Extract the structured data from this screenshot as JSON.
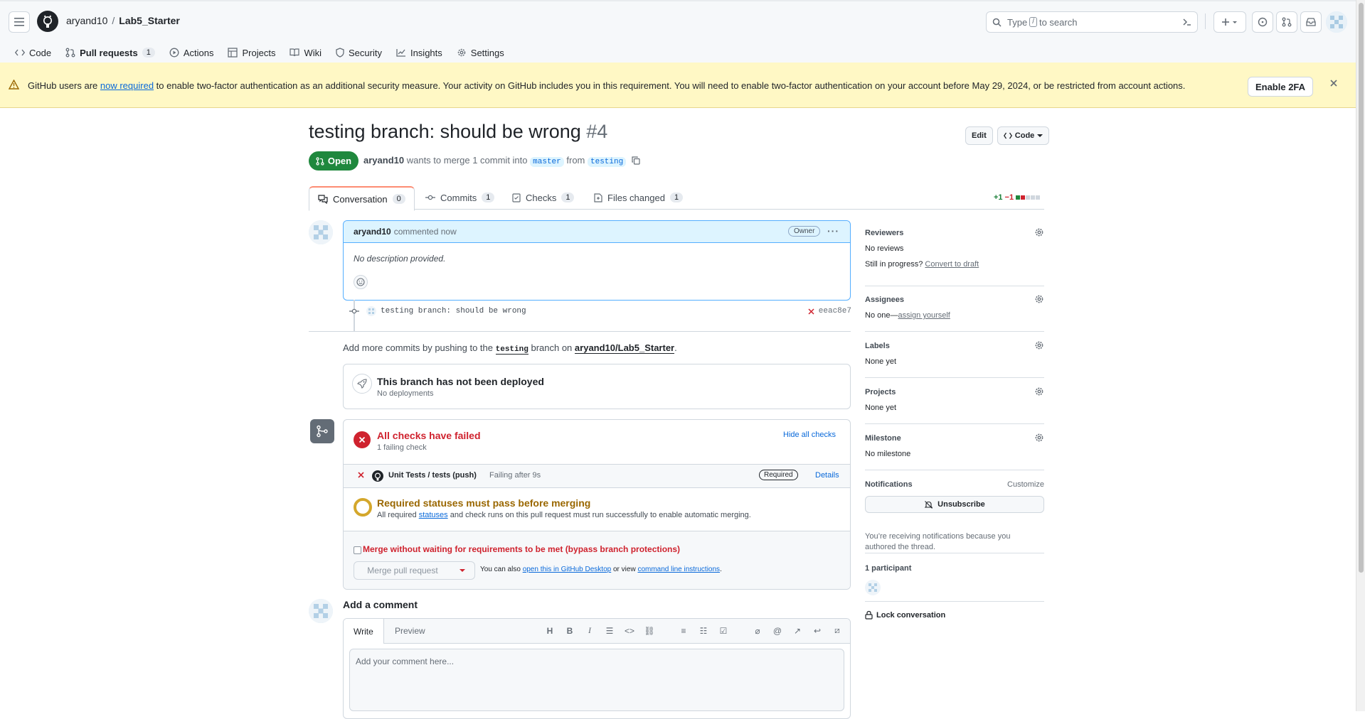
{
  "header": {
    "owner": "aryand10",
    "separator": "/",
    "repo": "Lab5_Starter",
    "search_placeholder_pre": "Type",
    "search_key": "/",
    "search_placeholder_post": "to search"
  },
  "repo_nav": [
    {
      "label": "Code",
      "icon": "code-icon"
    },
    {
      "label": "Pull requests",
      "icon": "pull-request-icon",
      "count": "1",
      "active": true
    },
    {
      "label": "Actions",
      "icon": "play-icon"
    },
    {
      "label": "Projects",
      "icon": "table-icon"
    },
    {
      "label": "Wiki",
      "icon": "book-icon"
    },
    {
      "label": "Security",
      "icon": "shield-icon"
    },
    {
      "label": "Insights",
      "icon": "graph-icon"
    },
    {
      "label": "Settings",
      "icon": "gear-icon"
    }
  ],
  "banner": {
    "text_pre": "GitHub users are",
    "link": "now required",
    "text_post": "to enable two-factor authentication as an additional security measure. Your activity on GitHub includes you in this requirement. You will need to enable two-factor authentication on your account before May 29, 2024, or be restricted from account actions.",
    "button": "Enable 2FA"
  },
  "pr": {
    "title": "testing branch: should be wrong",
    "number": "#4",
    "edit": "Edit",
    "code": "Code",
    "state": "Open",
    "author": "aryand10",
    "meta_mid": "wants to merge 1 commit into",
    "base": "master",
    "from": "from",
    "head": "testing"
  },
  "tabs": [
    {
      "label": "Conversation",
      "count": "0"
    },
    {
      "label": "Commits",
      "count": "1"
    },
    {
      "label": "Checks",
      "count": "1"
    },
    {
      "label": "Files changed",
      "count": "1"
    }
  ],
  "diffstat": {
    "add": "+1",
    "del": "−1"
  },
  "comment": {
    "author": "aryand10",
    "action": "commented now",
    "badge": "Owner",
    "body": "No description provided."
  },
  "commit": {
    "message": "testing branch: should be wrong",
    "sha": "eeac8e7"
  },
  "addmore": {
    "pre": "Add more commits by pushing to the",
    "branch": "testing",
    "mid": "branch on",
    "repo": "aryand10/Lab5_Starter",
    "end": "."
  },
  "deploy": {
    "title": "This branch has not been deployed",
    "sub": "No deployments"
  },
  "checks": {
    "title": "All checks have failed",
    "sub": "1 failing check",
    "hide": "Hide all checks",
    "check_name": "Unit Tests / tests (push)",
    "check_status": "Failing after 9s",
    "required": "Required",
    "details": "Details"
  },
  "required_status": {
    "title": "Required statuses must pass before merging",
    "pre": "All required",
    "link": "statuses",
    "post": "and check runs on this pull request must run successfully to enable automatic merging."
  },
  "merge": {
    "bypass": "Merge without waiting for requirements to be met (bypass branch protections)",
    "button": "Merge pull request",
    "also_pre": "You can also",
    "link1": "open this in GitHub Desktop",
    "also_mid": "or view",
    "link2": "command line instructions",
    "also_end": "."
  },
  "add_comment": {
    "title": "Add a comment",
    "write": "Write",
    "preview": "Preview",
    "placeholder": "Add your comment here..."
  },
  "sidebar": {
    "reviewers": {
      "label": "Reviewers",
      "value": "No reviews",
      "progress_pre": "Still in progress?",
      "progress_link": "Convert to draft"
    },
    "assignees": {
      "label": "Assignees",
      "pre": "No one—",
      "link": "assign yourself"
    },
    "labels": {
      "label": "Labels",
      "value": "None yet"
    },
    "projects": {
      "label": "Projects",
      "value": "None yet"
    },
    "milestone": {
      "label": "Milestone",
      "value": "No milestone"
    },
    "notifications": {
      "label": "Notifications",
      "customize": "Customize",
      "button": "Unsubscribe",
      "reason": "You’re receiving notifications because you authored the thread."
    },
    "participants": {
      "label": "1 participant"
    },
    "lock": "Lock conversation"
  }
}
